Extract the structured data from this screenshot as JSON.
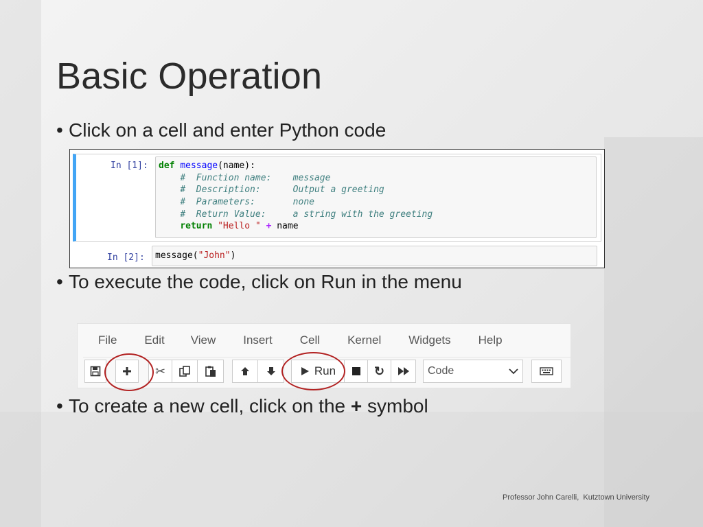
{
  "slide": {
    "title": "Basic Operation",
    "bullets": {
      "b1": "Click on a cell and enter Python code",
      "b2": "To execute the code, click on Run in the menu",
      "b3_pre": "To create a new cell, click on the ",
      "b3_sym": "+",
      "b3_post": " symbol"
    },
    "footer": "Professor John Carelli,  Kutztown University"
  },
  "notebook": {
    "cell1": {
      "prompt": "In [1]:",
      "lines": {
        "l1": {
          "kw": "def",
          "fn": "message",
          "rest": "(name):"
        },
        "l2": "#  Function name:    message",
        "l3": "#  Description:      Output a greeting",
        "l4": "#  Parameters:       none",
        "l5": "#  Return Value:     a string with the greeting",
        "l6": {
          "kw": "return",
          "str": "\"Hello \"",
          "op": "+",
          "rest": "name"
        }
      }
    },
    "cell2": {
      "prompt": "In [2]:",
      "code_pre": "message(",
      "code_str": "\"John\"",
      "code_post": ")"
    }
  },
  "jupyter": {
    "menu": [
      "File",
      "Edit",
      "View",
      "Insert",
      "Cell",
      "Kernel",
      "Widgets",
      "Help"
    ],
    "toolbar": {
      "run_label": "Run",
      "cell_type": "Code"
    },
    "icons": {
      "save": "save-icon",
      "add": "plus-icon",
      "cut": "scissors-icon",
      "copy": "copy-icon",
      "paste": "paste-icon",
      "up": "arrow-up-icon",
      "down": "arrow-down-icon",
      "run": "play-icon",
      "stop": "stop-icon",
      "restart": "restart-icon",
      "fast_forward": "fast-forward-icon",
      "keyboard": "keyboard-icon"
    },
    "highlight_color": "#b22222"
  }
}
